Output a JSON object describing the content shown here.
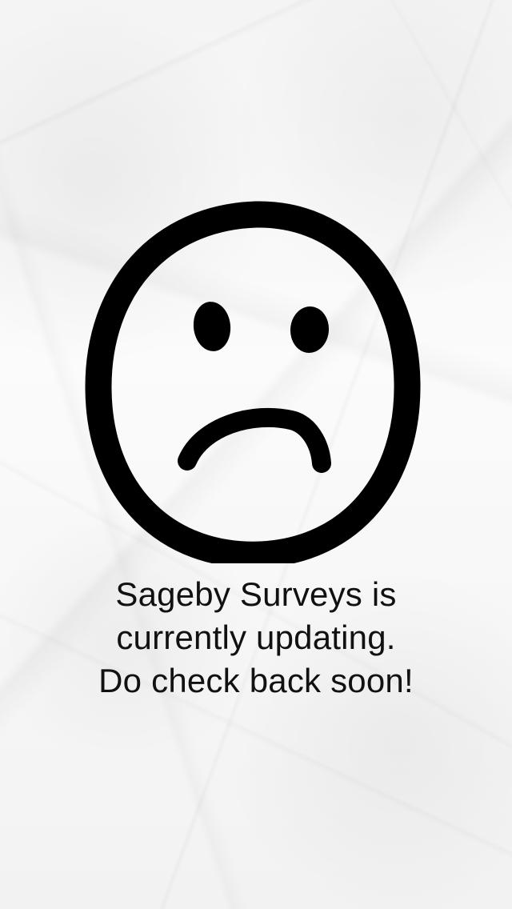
{
  "screen": {
    "background": "#f7f7f7",
    "text_color": "#111111",
    "icon_name": "sad-face-icon"
  },
  "message": {
    "line1": "Sageby Surveys is",
    "line2": "currently updating.",
    "line3": "Do check back soon!"
  }
}
